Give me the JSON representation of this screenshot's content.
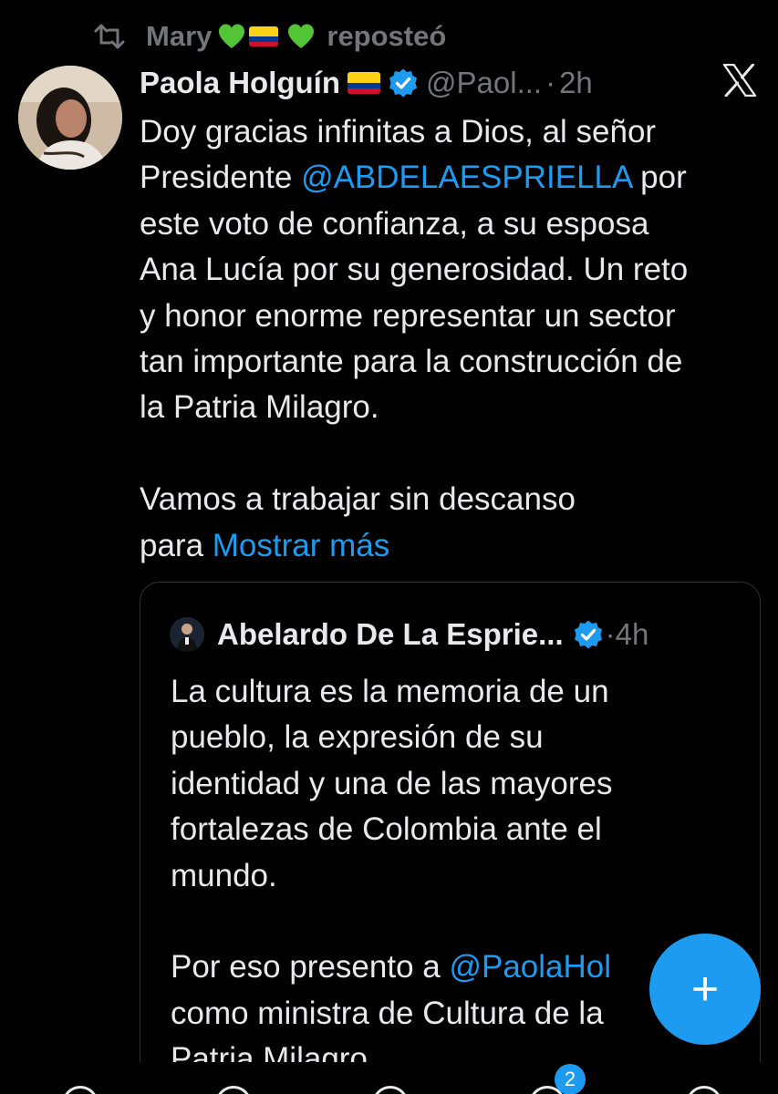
{
  "repost": {
    "user_name": "Mary",
    "verb": "reposteó",
    "icon": "repost-icon",
    "emoji": [
      "green-heart",
      "colombia-flag",
      "green-heart"
    ]
  },
  "tweet": {
    "author_name": "Paola Holguín",
    "author_flag": "colombia-flag",
    "handle": "@Paol...",
    "separator": "·",
    "time": "2h",
    "lines": [
      [
        {
          "t": "Doy gracias infinitas a Dios, al señor"
        }
      ],
      [
        {
          "t": "Presidente "
        },
        {
          "t": "@ABDELAESPRIELLA",
          "link": true
        },
        {
          "t": " por"
        }
      ],
      [
        {
          "t": "este voto de confianza, a su esposa"
        }
      ],
      [
        {
          "t": "Ana Lucía por su generosidad. Un reto"
        }
      ],
      [
        {
          "t": "y honor enorme representar un sector"
        }
      ],
      [
        {
          "t": "tan importante para la construcción de"
        }
      ],
      [
        {
          "t": "la Patria Milagro."
        }
      ],
      [],
      [
        {
          "t": "Vamos a trabajar sin descanso"
        }
      ],
      [
        {
          "t": "para "
        },
        {
          "t": "Mostrar más",
          "link": true
        }
      ]
    ]
  },
  "quote": {
    "author_name": "Abelardo De La Esprie...",
    "separator": "·",
    "time": "4h",
    "lines": [
      [
        {
          "t": "La cultura es la memoria de un"
        }
      ],
      [
        {
          "t": "pueblo, la expresión de su"
        }
      ],
      [
        {
          "t": "identidad y una de las mayores"
        }
      ],
      [
        {
          "t": "fortalezas de Colombia ante el"
        }
      ],
      [
        {
          "t": "mundo."
        }
      ],
      [],
      [
        {
          "t": "Por eso presento a "
        },
        {
          "t": "@PaolaHol",
          "link": true
        }
      ],
      [
        {
          "t": "como ministra de Cultura de la"
        }
      ],
      [
        {
          "t": "Patria Milagro."
        }
      ]
    ]
  },
  "fab": {
    "label": "+",
    "icon": "compose-plus-icon"
  },
  "tabbar": {
    "badge_count": "2"
  },
  "colors": {
    "background": "#000000",
    "text": "#e7e9ea",
    "muted": "#71767b",
    "accent": "#1d9bf0",
    "border": "#2f3336"
  }
}
